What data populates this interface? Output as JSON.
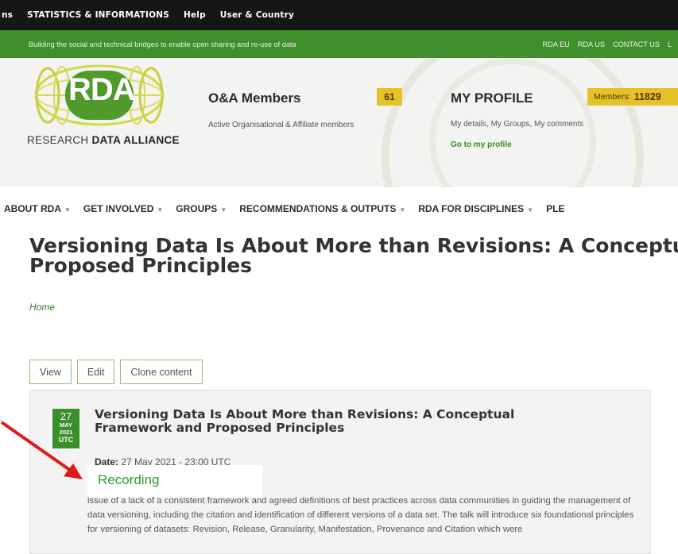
{
  "topbar": {
    "items": [
      "ns",
      "STATISTICS & INFORMATIONS",
      "Help",
      "User & Country"
    ]
  },
  "greenbar": {
    "tagline": "Building the social and technical bridges to enable open sharing and re-use of data",
    "links": [
      "RDA EU",
      "RDA US",
      "CONTACT US",
      "L"
    ]
  },
  "logo": {
    "mark": "RDA",
    "sub_light": "RESEARCH ",
    "sub_bold": "DATA ALLIANCE"
  },
  "om": {
    "title": "O&A Members",
    "count": "61",
    "description": "Active Organisational & Affiliate members"
  },
  "profile": {
    "title": "MY PROFILE",
    "badge_label": "Members:",
    "badge_value": "11829",
    "description": "My details, My Groups, My comments",
    "link": "Go to my profile"
  },
  "nav": {
    "items": [
      "ABOUT RDA",
      "GET INVOLVED",
      "GROUPS",
      "RECOMMENDATIONS & OUTPUTS",
      "RDA FOR DISCIPLINES",
      "PLE"
    ]
  },
  "page": {
    "title_line1": "Versioning Data Is About More than Revisions: A Conceptua",
    "title_line2": "Proposed Principles",
    "breadcrumb": "Home"
  },
  "tabs": [
    "View",
    "Edit",
    "Clone content"
  ],
  "event": {
    "day": "27",
    "month": "MAY",
    "year": "2021",
    "tz": "UTC",
    "title": "Versioning Data Is About More than Revisions: A Conceptual Framework and Proposed Principles",
    "date_label": "Date:",
    "date_value": "27 May 2021 - 23:00 UTC",
    "description": "issue of a lack of a consistent framework and agreed definitions of best practices across data communities in guiding the management of data versioning,  including the citation and identification of different versions of a data set. The talk will introduce six foundational principles for versioning of datasets: Revision, Release, Granularity, Manifestation, Provenance and Citation which were"
  },
  "annotation": {
    "label": "Recording",
    "arrow_color": "#e01818"
  },
  "colors": {
    "green": "#3f8f2c",
    "badge_yellow": "#e6c12a"
  }
}
